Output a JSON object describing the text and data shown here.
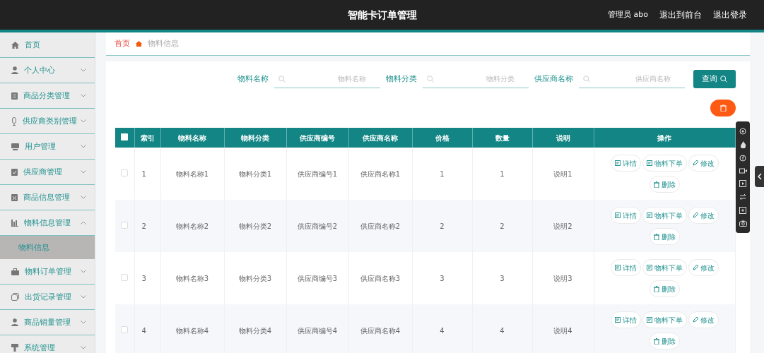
{
  "header": {
    "title": "智能卡订单管理",
    "user": "管理员 abo",
    "links": [
      "退出到前台",
      "退出登录"
    ]
  },
  "sidebar": {
    "items": [
      {
        "label": "首页",
        "kind": "link"
      },
      {
        "label": "个人中心",
        "kind": "menu",
        "expanded": false
      },
      {
        "label": "商品分类管理",
        "kind": "menu",
        "expanded": false
      },
      {
        "label": "供应商类别管理",
        "kind": "menu",
        "expanded": false
      },
      {
        "label": "用户管理",
        "kind": "menu",
        "expanded": false
      },
      {
        "label": "供应商管理",
        "kind": "menu",
        "expanded": false
      },
      {
        "label": "商品信息管理",
        "kind": "menu",
        "expanded": false
      },
      {
        "label": "物料信息管理",
        "kind": "menu",
        "expanded": true,
        "children": [
          {
            "label": "物料信息",
            "selected": true
          }
        ]
      },
      {
        "label": "物料订单管理",
        "kind": "menu",
        "expanded": false
      },
      {
        "label": "出货记录管理",
        "kind": "menu",
        "expanded": false
      },
      {
        "label": "商品销量管理",
        "kind": "menu",
        "expanded": false
      },
      {
        "label": "系统管理",
        "kind": "menu",
        "expanded": false
      }
    ]
  },
  "breadcrumb": [
    "首页",
    "物料信息"
  ],
  "search": {
    "fields": [
      {
        "label": "物料名称",
        "placeholder": "物料名称"
      },
      {
        "label": "物料分类",
        "placeholder": "物料分类"
      },
      {
        "label": "供应商名称",
        "placeholder": "供应商名称"
      }
    ],
    "button": "查询"
  },
  "table": {
    "select_all_checked": false,
    "columns": [
      "索引",
      "物料名称",
      "物料分类",
      "供应商编号",
      "供应商名称",
      "价格",
      "数量",
      "说明",
      "操作"
    ],
    "rows": [
      {
        "checked": false,
        "cells": [
          "1",
          "物料名称1",
          "物料分类1",
          "供应商编号1",
          "供应商名称1",
          "1",
          "1",
          "说明1"
        ],
        "actions": [
          "详情",
          "物料下单",
          "修改",
          "删除"
        ]
      },
      {
        "checked": false,
        "cells": [
          "2",
          "物料名称2",
          "物料分类2",
          "供应商编号2",
          "供应商名称2",
          "2",
          "2",
          "说明2"
        ],
        "actions": [
          "详情",
          "物料下单",
          "修改",
          "删除"
        ]
      },
      {
        "checked": false,
        "cells": [
          "3",
          "物料名称3",
          "物料分类3",
          "供应商编号3",
          "供应商名称3",
          "3",
          "3",
          "说明3"
        ],
        "actions": [
          "详情",
          "物料下单",
          "修改",
          "删除"
        ]
      },
      {
        "checked": false,
        "cells": [
          "4",
          "物料名称4",
          "物料分类4",
          "供应商编号4",
          "供应商名称4",
          "4",
          "4",
          "说明4"
        ],
        "actions": [
          "详情",
          "物料下单",
          "修改",
          "删除"
        ]
      }
    ]
  }
}
